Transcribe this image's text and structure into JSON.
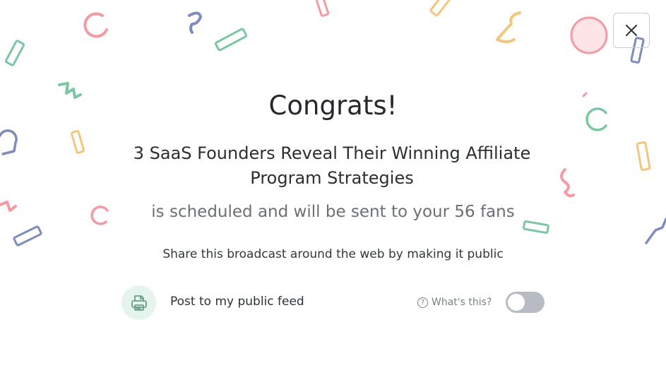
{
  "modal": {
    "heading": "Congrats!",
    "post_title": "3 SaaS Founders Reveal Their Winning Affiliate Program Strategies",
    "schedule_message": "is scheduled and will be sent to your 56 fans",
    "share_prompt": "Share this broadcast around the web by making it public",
    "feed_option": {
      "label": "Post to my public feed",
      "help_label": "What's this?",
      "icon": "printer-feed-icon",
      "enabled": false
    },
    "close_icon": "close-icon"
  },
  "colors": {
    "confetti_red": "#f49aa3",
    "confetti_green": "#7cc7a2",
    "confetti_blue": "#7d8bbf",
    "confetti_yellow": "#f2c77d",
    "toggle_off": "#b7bcc3",
    "icon_bg": "#e6f4ee"
  }
}
